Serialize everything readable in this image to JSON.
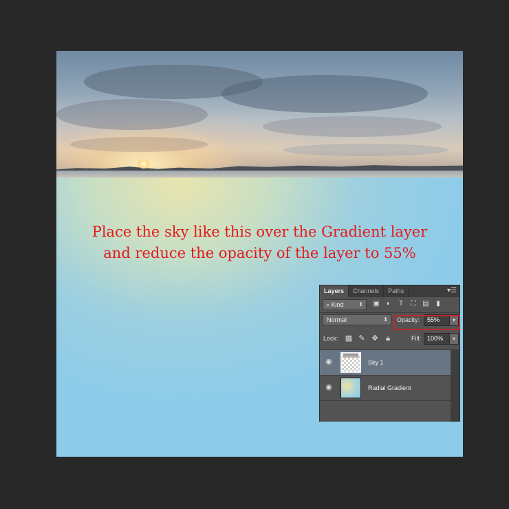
{
  "caption": "Place the sky like this over the Gradient layer\nand reduce the opacity of the layer to 55%",
  "layers_panel": {
    "tabs": [
      "Layers",
      "Channels",
      "Paths"
    ],
    "filter": {
      "kind_label": "Kind"
    },
    "blend_mode": "Normal",
    "opacity_label": "Opacity:",
    "opacity_value": "55%",
    "lock_label": "Lock:",
    "fill_label": "Fill:",
    "fill_value": "100%",
    "layers": [
      {
        "name": "Sky 1",
        "selected": true
      },
      {
        "name": "Radial Gradient",
        "selected": false
      }
    ]
  },
  "colors": {
    "caption": "#e21b1b",
    "highlight_box": "#c0272d",
    "selected_layer": "#687585"
  }
}
